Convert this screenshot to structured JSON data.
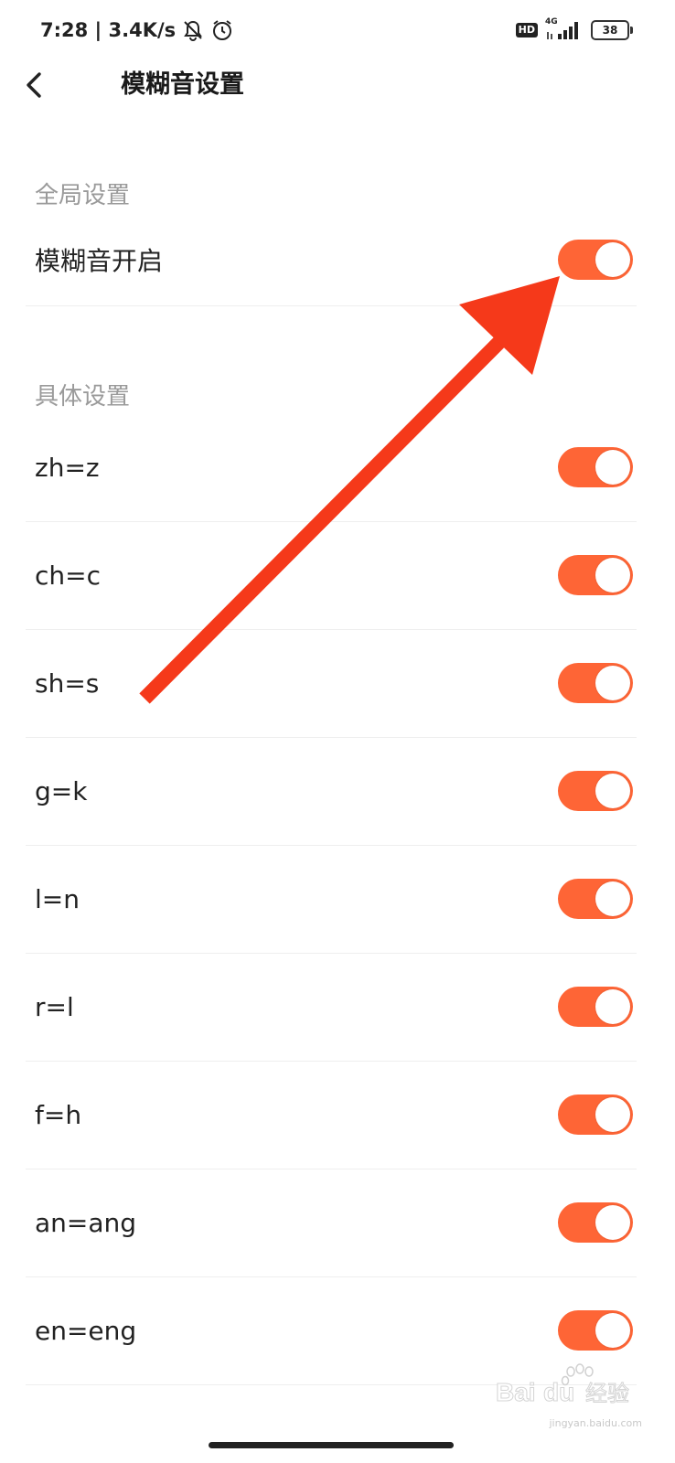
{
  "status_bar": {
    "time": "7:28 | 3.4K/s",
    "hd_badge": "HD",
    "network_type": "4G",
    "battery_level": "38",
    "icons": [
      "mute-icon",
      "alarm-icon",
      "hd-icon",
      "signal-icon",
      "battery-icon"
    ]
  },
  "header": {
    "back_icon": "chevron-left-icon",
    "title": "模糊音设置"
  },
  "global_section": {
    "title": "全局设置",
    "item": {
      "label": "模糊音开启",
      "enabled": true
    }
  },
  "specific_section": {
    "title": "具体设置",
    "items": [
      {
        "label": "zh=z",
        "enabled": true
      },
      {
        "label": "ch=c",
        "enabled": true
      },
      {
        "label": "sh=s",
        "enabled": true
      },
      {
        "label": "g=k",
        "enabled": true
      },
      {
        "label": "l=n",
        "enabled": true
      },
      {
        "label": "r=l",
        "enabled": true
      },
      {
        "label": "f=h",
        "enabled": true
      },
      {
        "label": "an=ang",
        "enabled": true
      },
      {
        "label": "en=eng",
        "enabled": true
      }
    ]
  },
  "watermark": {
    "logo_text": "Bai",
    "logo_text2": "du",
    "logo_cn": "经验",
    "site": "jingyan.baidu.com"
  },
  "colors": {
    "toggle_on": "#fe6536",
    "arrow": "#f5391a",
    "section_title": "#9a9a9a"
  }
}
